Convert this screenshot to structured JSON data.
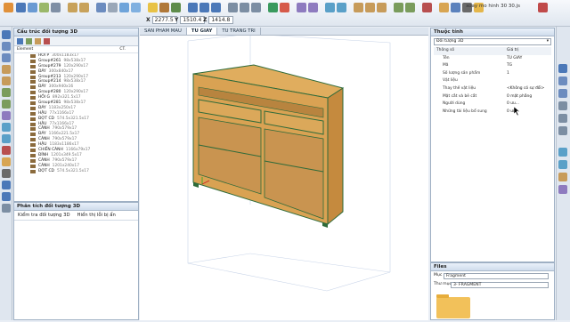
{
  "toolbar": {
    "x_label": "X",
    "x_value": "2277.5",
    "y_label": "Y",
    "y_value": "1510.4",
    "z_label": "Z",
    "z_value": "1414.8",
    "window_title": "xoay mo hinh 30 30.js"
  },
  "tree_panel": {
    "title": "Cấu trúc đối tượng 3D",
    "col_element": "Element",
    "col_ct": "CT.",
    "items": [
      {
        "name": "HỒI P",
        "dim": "300x1183x17"
      },
      {
        "name": "Group#261",
        "dim": "98x538x17"
      },
      {
        "name": "Group#279",
        "dim": "120x290x17"
      },
      {
        "name": "ĐÁY",
        "dim": "300x840x17"
      },
      {
        "name": "Group#213",
        "dim": "120x290x17"
      },
      {
        "name": "Group#214",
        "dim": "98x538x17"
      },
      {
        "name": "ĐÁY",
        "dim": "300x940x16"
      },
      {
        "name": "Group#280",
        "dim": "120x290x17"
      },
      {
        "name": "HỒI G",
        "dim": "892x321.5x17"
      },
      {
        "name": "Group#281",
        "dim": "98x538x17"
      },
      {
        "name": "ĐÁY",
        "dim": "1183x250x17"
      },
      {
        "name": "HẬU",
        "dim": "77x1166x17"
      },
      {
        "name": "ĐỢT CD",
        "dim": "574.5x321.5x17"
      },
      {
        "name": "HẬU",
        "dim": "77x1166x17"
      },
      {
        "name": "CÁNH",
        "dim": "790x579x17"
      },
      {
        "name": "ĐÁY",
        "dim": "1166x221.5x17"
      },
      {
        "name": "CÁNH",
        "dim": "790x579x17"
      },
      {
        "name": "HẬU",
        "dim": "1183x1186x17"
      },
      {
        "name": "CHIẾN CÁNH",
        "dim": "1166x79x17"
      },
      {
        "name": "ĐÍNH",
        "dim": "1201x349.5x17"
      },
      {
        "name": "CÁNH",
        "dim": "790x579x17"
      },
      {
        "name": "CÁNH",
        "dim": "1201x240x17"
      },
      {
        "name": "ĐỢT CD",
        "dim": "574.5x321.5x17"
      }
    ]
  },
  "analysis_panel": {
    "title": "Phân tích đối tượng 3D",
    "check_label": "Kiểm tra đối tượng 3D",
    "show_error_label": "Hiển thị lỗi bị ẩn"
  },
  "tabs": [
    {
      "label": "SAN PHAM MAU"
    },
    {
      "label": "TU GIAY"
    },
    {
      "label": "TU TRANG TRI"
    }
  ],
  "properties": {
    "title": "Thuộc tính",
    "selector": "Đối tượng 3D",
    "header_key": "Thông số",
    "header_value": "Giá trị",
    "rows": [
      {
        "key": "Tên",
        "value": "TU GIAY"
      },
      {
        "key": "Mã",
        "value": "TG"
      },
      {
        "key": "Số lượng sản phẩm",
        "value": "1"
      },
      {
        "key": "Vật liệu",
        "value": ""
      },
      {
        "key": "Thay thế vật liệu",
        "value": "<Không có sự đổi>"
      },
      {
        "key": "Mặt cắt và bẻ cắt",
        "value": "0 mặt phẳng"
      },
      {
        "key": "Người dùng",
        "value": "0 ưu..."
      },
      {
        "key": "Những tài liệu bổ sung",
        "value": "0 ưu..."
      }
    ]
  },
  "files": {
    "title": "Files",
    "muc_label": "Mục",
    "muc_value": "Fragment",
    "folder_label": "Thư mục",
    "folder_value": "3- FRAGMENT"
  },
  "colors": {
    "wood": "#d9a253",
    "edge": "#2f6b3a",
    "panel_header": "#cfdcec"
  }
}
